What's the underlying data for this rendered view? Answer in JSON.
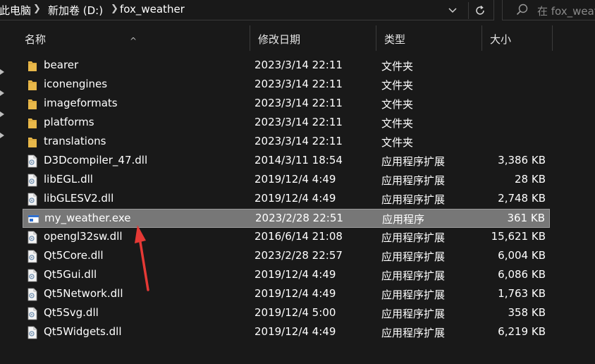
{
  "breadcrumb": {
    "items": [
      {
        "label": "此电脑"
      },
      {
        "label": "新加卷 (D:)"
      },
      {
        "label": "fox_weather"
      }
    ]
  },
  "search": {
    "placeholder": "在 fox_weather 中搜索",
    "visible_text": "在 fox_weat"
  },
  "columns": {
    "name": "名称",
    "date": "修改日期",
    "type": "类型",
    "size": "大小"
  },
  "files": [
    {
      "icon": "folder-icon",
      "name": "bearer",
      "date": "2023/3/14 22:11",
      "type": "文件夹",
      "size": ""
    },
    {
      "icon": "folder-icon",
      "name": "iconengines",
      "date": "2023/3/14 22:11",
      "type": "文件夹",
      "size": ""
    },
    {
      "icon": "folder-icon",
      "name": "imageformats",
      "date": "2023/3/14 22:11",
      "type": "文件夹",
      "size": ""
    },
    {
      "icon": "folder-icon",
      "name": "platforms",
      "date": "2023/3/14 22:11",
      "type": "文件夹",
      "size": ""
    },
    {
      "icon": "folder-icon",
      "name": "translations",
      "date": "2023/3/14 22:11",
      "type": "文件夹",
      "size": ""
    },
    {
      "icon": "dll-icon",
      "name": "D3Dcompiler_47.dll",
      "date": "2014/3/11 18:54",
      "type": "应用程序扩展",
      "size": "3,386 KB"
    },
    {
      "icon": "dll-icon",
      "name": "libEGL.dll",
      "date": "2019/12/4 4:49",
      "type": "应用程序扩展",
      "size": "28 KB"
    },
    {
      "icon": "dll-icon",
      "name": "libGLESV2.dll",
      "date": "2019/12/4 4:49",
      "type": "应用程序扩展",
      "size": "2,748 KB"
    },
    {
      "icon": "exe-icon",
      "name": "my_weather.exe",
      "date": "2023/2/28 22:51",
      "type": "应用程序",
      "size": "361 KB",
      "selected": true
    },
    {
      "icon": "dll-icon",
      "name": "opengl32sw.dll",
      "date": "2016/6/14 21:08",
      "type": "应用程序扩展",
      "size": "15,621 KB"
    },
    {
      "icon": "dll-icon",
      "name": "Qt5Core.dll",
      "date": "2023/2/28 22:57",
      "type": "应用程序扩展",
      "size": "6,004 KB"
    },
    {
      "icon": "dll-icon",
      "name": "Qt5Gui.dll",
      "date": "2019/12/4 4:49",
      "type": "应用程序扩展",
      "size": "6,086 KB"
    },
    {
      "icon": "dll-icon",
      "name": "Qt5Network.dll",
      "date": "2019/12/4 4:49",
      "type": "应用程序扩展",
      "size": "1,763 KB"
    },
    {
      "icon": "dll-icon",
      "name": "Qt5Svg.dll",
      "date": "2019/12/4 5:00",
      "type": "应用程序扩展",
      "size": "358 KB"
    },
    {
      "icon": "dll-icon",
      "name": "Qt5Widgets.dll",
      "date": "2019/12/4 4:49",
      "type": "应用程序扩展",
      "size": "6,219 KB"
    }
  ],
  "colors": {
    "background": "#191919",
    "selection": "#777777",
    "folder": "#e8b84a",
    "annotation_arrow": "#e53935"
  }
}
